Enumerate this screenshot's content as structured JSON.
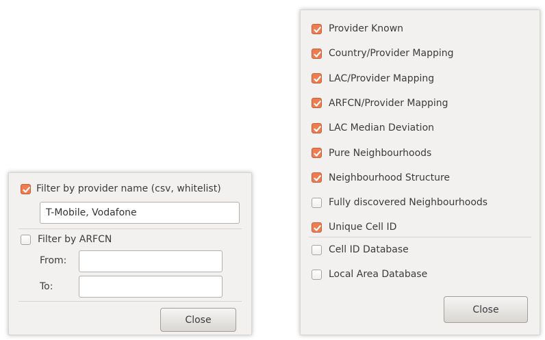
{
  "left_dialog": {
    "filter_provider": {
      "label": "Filter by provider name (csv, whitelist)",
      "checked": true
    },
    "provider_input": {
      "value": "T-Mobile, Vodafone"
    },
    "filter_arfcn": {
      "label": "Filter by ARFCN",
      "checked": false
    },
    "from": {
      "label": "From:",
      "value": ""
    },
    "to": {
      "label": "To:",
      "value": ""
    },
    "close_label": "Close"
  },
  "right_dialog": {
    "checks": [
      {
        "label": "Provider Known",
        "checked": true
      },
      {
        "label": "Country/Provider Mapping",
        "checked": true
      },
      {
        "label": "LAC/Provider Mapping",
        "checked": true
      },
      {
        "label": "ARFCN/Provider Mapping",
        "checked": true
      },
      {
        "label": "LAC Median Deviation",
        "checked": true
      },
      {
        "label": "Pure Neighbourhoods",
        "checked": true
      },
      {
        "label": "Neighbourhood Structure",
        "checked": true
      },
      {
        "label": "Fully discovered Neighbourhoods",
        "checked": false
      },
      {
        "label": "Unique Cell ID",
        "checked": true
      }
    ],
    "db_checks": [
      {
        "label": "Cell ID Database",
        "checked": false
      },
      {
        "label": "Local Area Database",
        "checked": false
      }
    ],
    "close_label": "Close"
  },
  "colors": {
    "accent": "#ef7c50",
    "dialog_bg": "#f2f1f0"
  }
}
